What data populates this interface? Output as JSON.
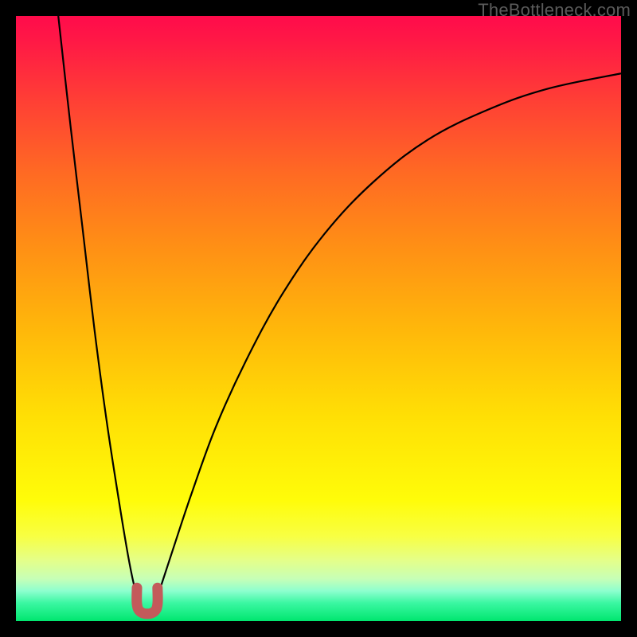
{
  "watermark": {
    "text": "TheBottleneck.com"
  },
  "chart_data": {
    "type": "line",
    "title": "",
    "xlabel": "",
    "ylabel": "",
    "xlim": [
      0,
      100
    ],
    "ylim": [
      0,
      100
    ],
    "series": [
      {
        "name": "left-curve",
        "type": "line",
        "points": [
          {
            "x": 7.0,
            "y": 100.0
          },
          {
            "x": 9.0,
            "y": 82.0
          },
          {
            "x": 11.0,
            "y": 65.0
          },
          {
            "x": 13.0,
            "y": 48.0
          },
          {
            "x": 15.0,
            "y": 33.0
          },
          {
            "x": 17.0,
            "y": 20.0
          },
          {
            "x": 18.5,
            "y": 11.0
          },
          {
            "x": 19.5,
            "y": 6.0
          },
          {
            "x": 20.2,
            "y": 3.5
          }
        ]
      },
      {
        "name": "right-curve",
        "type": "line",
        "points": [
          {
            "x": 23.2,
            "y": 3.5
          },
          {
            "x": 24.2,
            "y": 6.5
          },
          {
            "x": 26.0,
            "y": 12.0
          },
          {
            "x": 29.0,
            "y": 21.0
          },
          {
            "x": 33.0,
            "y": 32.0
          },
          {
            "x": 38.0,
            "y": 43.0
          },
          {
            "x": 44.0,
            "y": 54.0
          },
          {
            "x": 51.0,
            "y": 64.0
          },
          {
            "x": 59.0,
            "y": 72.5
          },
          {
            "x": 68.0,
            "y": 79.5
          },
          {
            "x": 78.0,
            "y": 84.5
          },
          {
            "x": 88.0,
            "y": 88.0
          },
          {
            "x": 100.0,
            "y": 90.5
          }
        ]
      },
      {
        "name": "marker-u",
        "type": "line",
        "points": [
          {
            "x": 20.0,
            "y": 5.5
          },
          {
            "x": 20.0,
            "y": 2.8
          },
          {
            "x": 20.5,
            "y": 1.6
          },
          {
            "x": 21.7,
            "y": 1.2
          },
          {
            "x": 22.9,
            "y": 1.6
          },
          {
            "x": 23.4,
            "y": 2.8
          },
          {
            "x": 23.4,
            "y": 5.5
          }
        ]
      }
    ],
    "background_gradient": {
      "direction": "vertical",
      "stops": [
        {
          "pos": 0.0,
          "color": "#ff0b4b"
        },
        {
          "pos": 0.5,
          "color": "#ffc107"
        },
        {
          "pos": 0.8,
          "color": "#fffc09"
        },
        {
          "pos": 1.0,
          "color": "#00e66f"
        }
      ]
    },
    "marker_color": "#c35a5b",
    "curve_color": "#000000"
  }
}
